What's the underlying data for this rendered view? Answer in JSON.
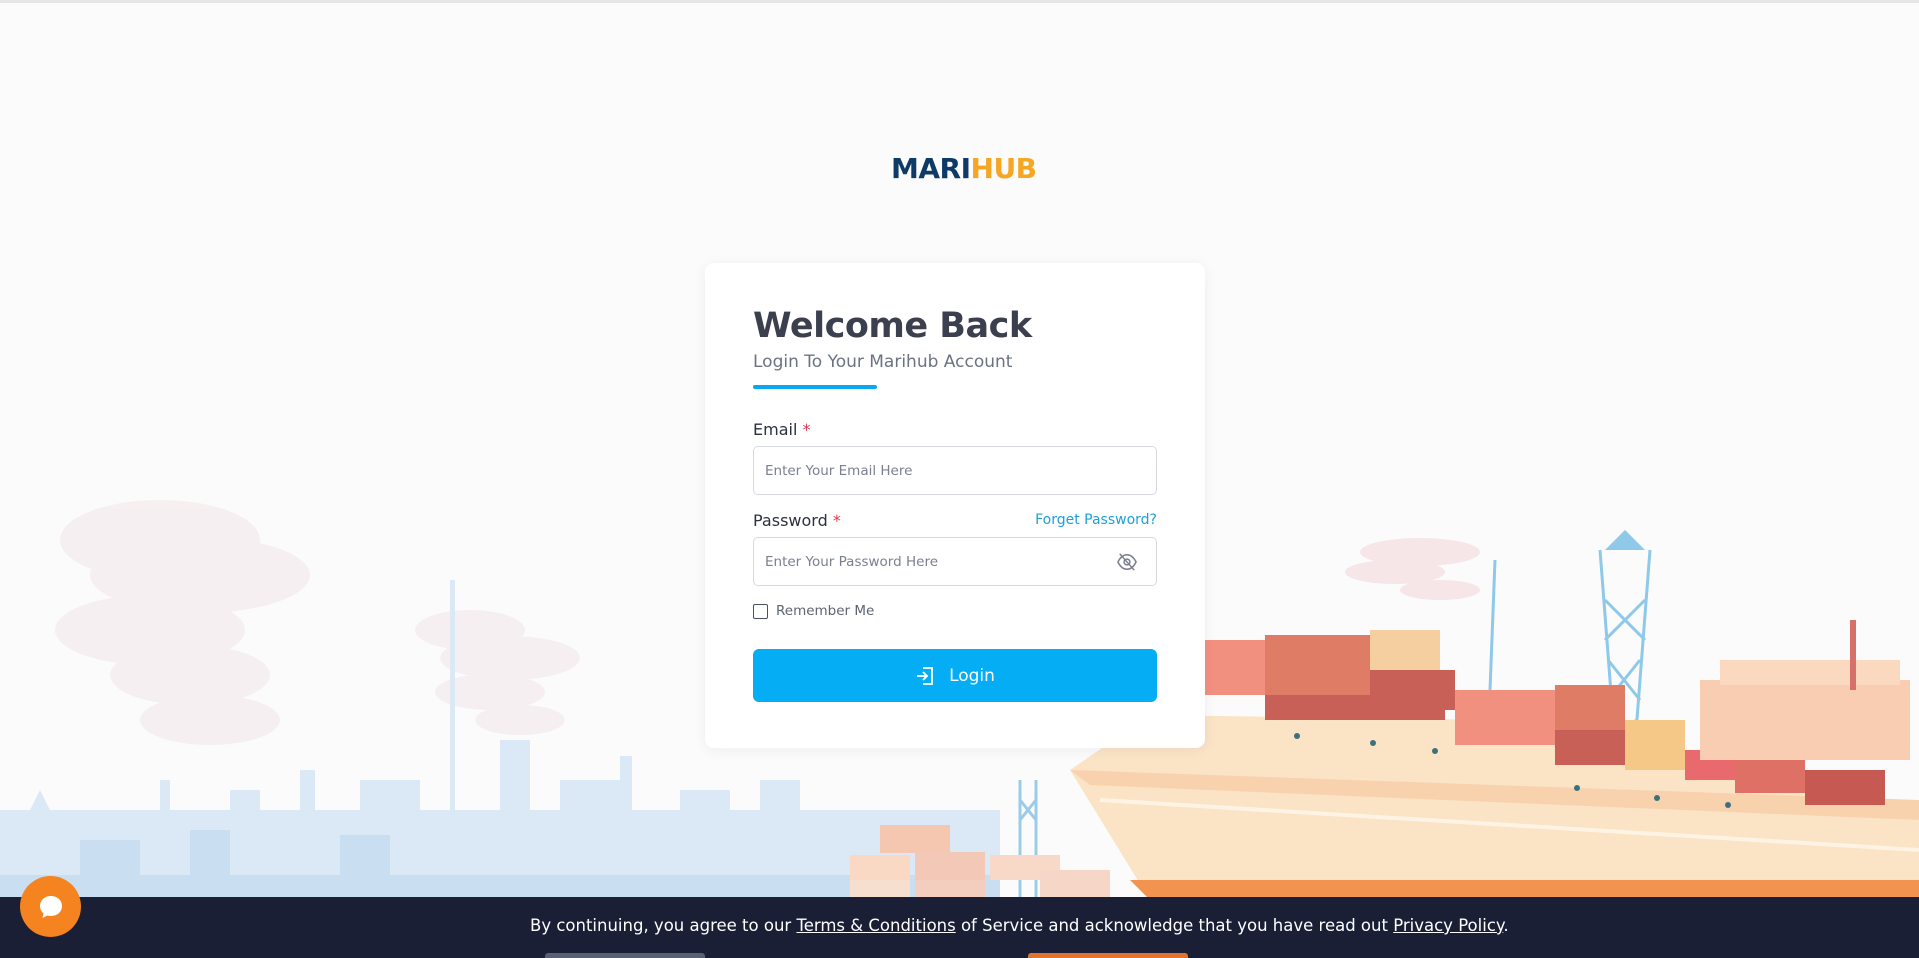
{
  "logo": {
    "part1": "MARI",
    "part2": "HUB"
  },
  "login": {
    "title": "Welcome Back",
    "subtitle": "Login To Your Marihub Account",
    "email_label": "Email",
    "password_label": "Password",
    "required_mark": "*",
    "email_placeholder": "Enter Your Email Here",
    "password_placeholder": "Enter Your Password Here",
    "forgot_link": "Forget Password?",
    "remember_label": "Remember Me",
    "login_button": "Login"
  },
  "consent": {
    "prefix": "By continuing, you agree to our ",
    "terms_link": "Terms & Conditions",
    "middle": " of Service and acknowledge that you have read out ",
    "privacy_link": "Privacy Policy",
    "suffix": "."
  },
  "icons": {
    "password_toggle": "eye-off-icon",
    "login": "login-arrow-icon",
    "chat": "chat-bubble-icon"
  },
  "colors": {
    "accent": "#04adf4",
    "logo_dark": "#0d3a66",
    "logo_orange": "#f5a623",
    "consent_bg": "#1a1f36",
    "chat_bg": "#f5831f",
    "required": "#e5334b"
  }
}
